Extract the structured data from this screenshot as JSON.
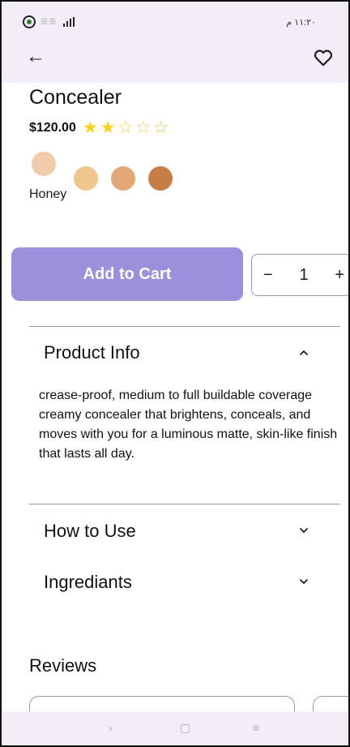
{
  "status_bar": {
    "time": "١١:٢٠ م",
    "faint_icons": "ꕥꕥ",
    "signal_icon": "signal-icon",
    "app_icon": "notification-app-icon"
  },
  "app_bar": {
    "back_icon": "arrow-back-icon",
    "back_glyph": "←",
    "favorite_icon": "heart-outline-icon"
  },
  "product": {
    "title": "Concealer",
    "price": "$120.00",
    "rating": 2,
    "rating_max": 5,
    "star_filled": "★",
    "star_empty": "☆",
    "selected_shade": "Honey",
    "shade_colors": [
      "#f0ccac",
      "#f1c68e",
      "#e2a877",
      "#c77e44"
    ]
  },
  "actions": {
    "add_to_cart_label": "Add to Cart",
    "quantity": "1",
    "minus": "−",
    "plus": "+",
    "accent_color": "#9e8fdc"
  },
  "sections": {
    "product_info": {
      "label": "Product Info",
      "expanded": true,
      "text": " crease-proof, medium to full buildable coverage creamy concealer that brightens, conceals, and moves with you for a luminous matte, skin-like finish that lasts all day."
    },
    "how_to_use": {
      "label": "How to Use",
      "expanded": false
    },
    "ingredients": {
      "label": "Ingrediants",
      "expanded": false
    }
  },
  "reviews": {
    "heading": "Reviews"
  },
  "nav": {
    "back_glyph": "›",
    "home_glyph": "▢",
    "recents_glyph": "≡"
  }
}
